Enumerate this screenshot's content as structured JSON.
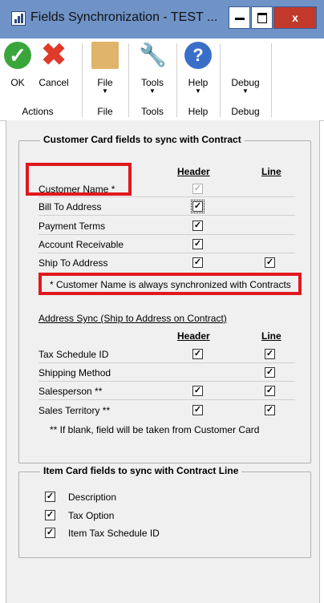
{
  "window": {
    "title": "Fields Synchronization  -  TEST ...",
    "close_glyph": "x"
  },
  "ribbon": {
    "ok_label": "OK",
    "cancel_label": "Cancel",
    "file_label": "File",
    "tools_label": "Tools",
    "help_label": "Help",
    "debug_label": "Debug",
    "help_glyph": "?",
    "groups": {
      "actions": "Actions",
      "file": "File",
      "tools": "Tools",
      "help": "Help",
      "debug": "Debug"
    }
  },
  "customer_card": {
    "title": "Customer Card fields to sync with Contract",
    "header_col": "Header",
    "line_col": "Line",
    "rows": [
      {
        "label": "Customer Name *",
        "header": true,
        "header_disabled": true,
        "line": null
      },
      {
        "label": "Bill To Address",
        "header": true,
        "line": null
      },
      {
        "label": "Payment Terms",
        "header": true,
        "line": null
      },
      {
        "label": "Account Receivable",
        "header": true,
        "line": null
      },
      {
        "label": "Ship To Address",
        "header": true,
        "line": true
      }
    ],
    "note": "* Customer Name is always synchronized with Contracts"
  },
  "address_sync": {
    "title": "Address Sync (Ship to Address on Contract)",
    "header_col": "Header",
    "line_col": "Line",
    "rows": [
      {
        "label": "Tax Schedule ID",
        "header": true,
        "line": true
      },
      {
        "label": "Shipping Method",
        "header": null,
        "line": true
      },
      {
        "label": "Salesperson **",
        "header": true,
        "line": true
      },
      {
        "label": "Sales Territory **",
        "header": true,
        "line": true
      }
    ],
    "note": "** If blank, field will be taken from Customer Card"
  },
  "item_card": {
    "title": "Item Card fields to sync with Contract Line",
    "items": [
      {
        "label": "Description",
        "checked": true
      },
      {
        "label": "Tax Option",
        "checked": true
      },
      {
        "label": "Item Tax Schedule ID",
        "checked": true
      }
    ]
  },
  "check_glyph": "✓",
  "colors": {
    "titlebar": "#6f93c7",
    "highlight": "#e0181e",
    "close": "#c0392b"
  }
}
